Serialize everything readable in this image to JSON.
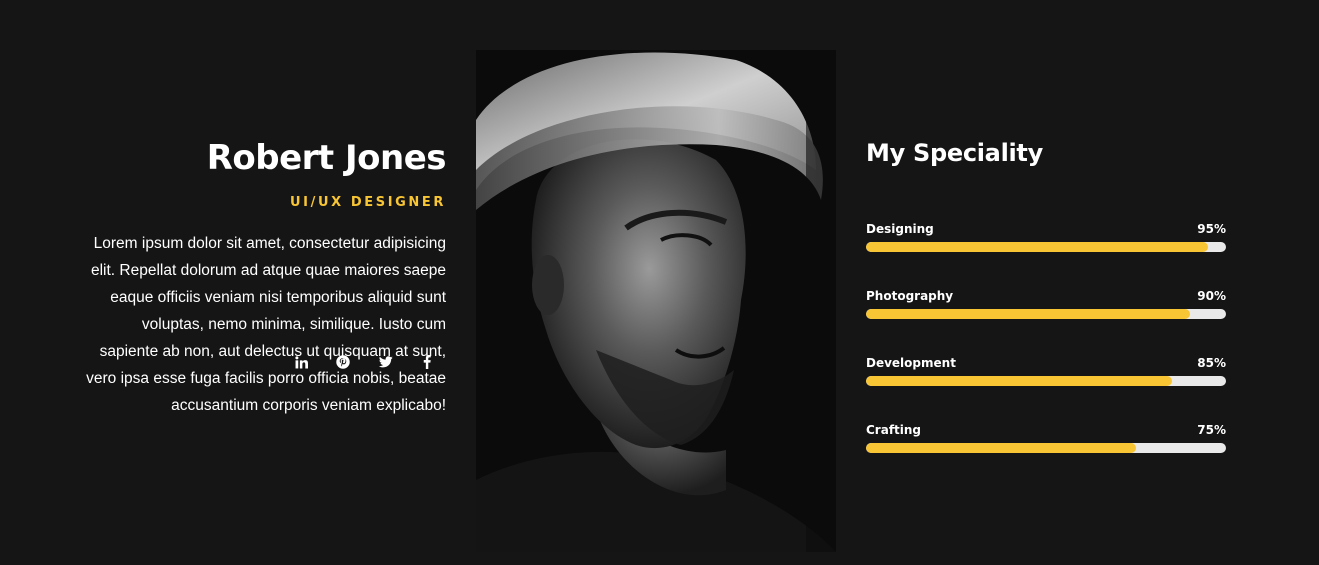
{
  "profile": {
    "name": "Robert Jones",
    "role": "UI/UX DESIGNER",
    "bio": "Lorem ipsum dolor sit amet, consectetur adipisicing elit. Repellat dolorum ad atque quae maiores saepe eaque officiis veniam nisi temporibus aliquid sunt voluptas, nemo minima, similique. Iusto cum sapiente ab non, aut delectus ut quisquam at sunt, vero ipsa esse fuga facilis porro officia nobis, beatae accusantium corporis veniam explicabo!",
    "social": [
      {
        "icon": "linkedin-icon"
      },
      {
        "icon": "pinterest-icon"
      },
      {
        "icon": "twitter-icon"
      },
      {
        "icon": "facebook-icon"
      }
    ]
  },
  "speciality": {
    "title": "My Speciality",
    "skills": [
      {
        "label": "Designing",
        "percent_text": "95%",
        "percent": 95
      },
      {
        "label": "Photography",
        "percent_text": "90%",
        "percent": 90
      },
      {
        "label": "Development",
        "percent_text": "85%",
        "percent": 85
      },
      {
        "label": "Crafting",
        "percent_text": "75%",
        "percent": 75
      }
    ]
  },
  "colors": {
    "background": "#151515",
    "accent": "#f8c535",
    "track": "#e9e9e9",
    "text": "#ffffff"
  }
}
